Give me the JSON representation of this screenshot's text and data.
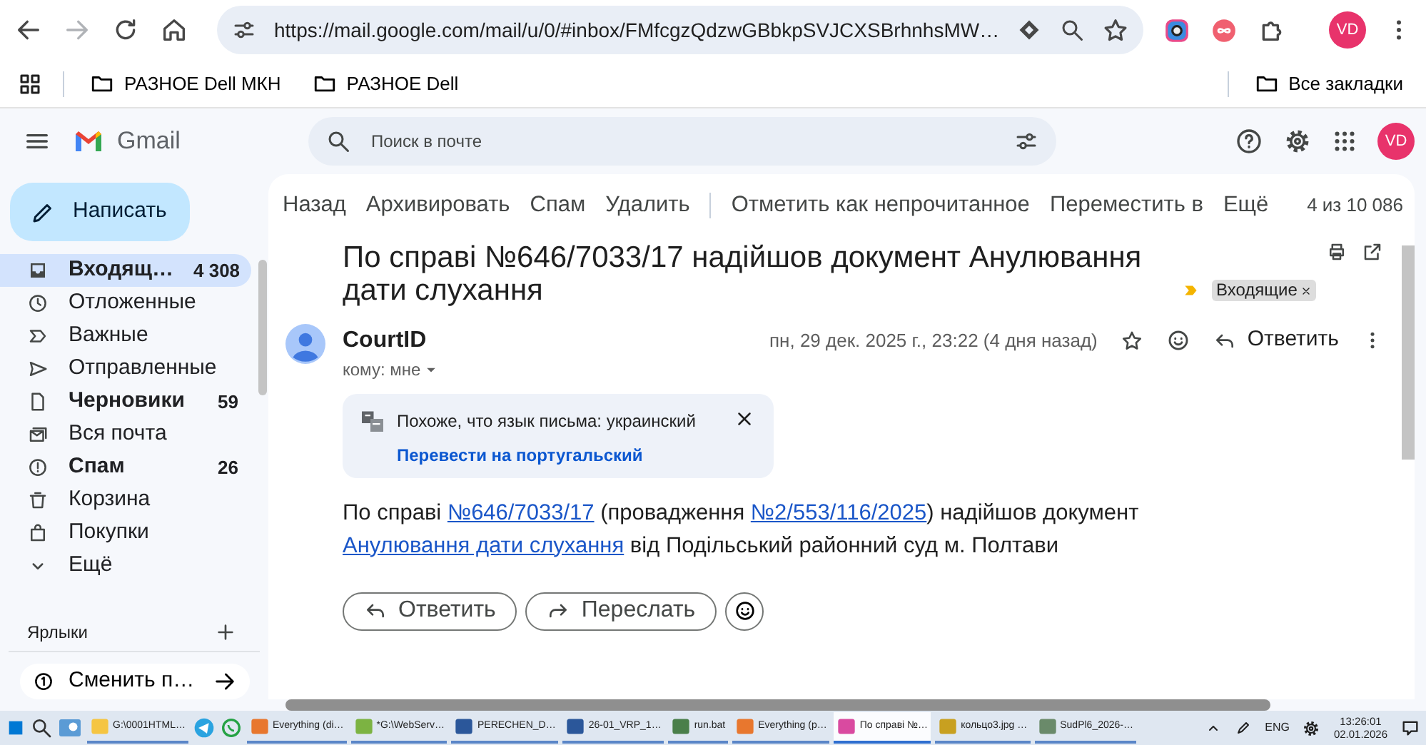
{
  "browser": {
    "url": "https://mail.google.com/mail/u/0/#inbox/FMfcgzQdzwGBbkpSVJCXSBrhnhsMW…",
    "profile": "VD",
    "bookmarks": [
      "РАЗНОЕ Dell МКН",
      "РАЗНОЕ Dell"
    ],
    "all_bookmarks": "Все закладки"
  },
  "gmail": {
    "product": "Gmail",
    "search_placeholder": "Поиск в почте",
    "account": "VD"
  },
  "sidebar": {
    "compose": "Написать",
    "folders": [
      {
        "label": "Входящ…",
        "count": "4 308",
        "unread": true,
        "selected": true
      },
      {
        "label": "Отложенные",
        "unread": false,
        "selected": false
      },
      {
        "label": "Важные",
        "unread": false,
        "selected": false
      },
      {
        "label": "Отправленные",
        "unread": false,
        "selected": false
      },
      {
        "label": "Черновики",
        "count": "59",
        "unread": true,
        "selected": false
      },
      {
        "label": "Вся почта",
        "unread": false,
        "selected": false
      },
      {
        "label": "Спам",
        "count": "26",
        "unread": true,
        "selected": false
      },
      {
        "label": "Корзина",
        "unread": false,
        "selected": false
      },
      {
        "label": "Покупки",
        "unread": false,
        "selected": false
      },
      {
        "label": "Ещё",
        "unread": false,
        "selected": false
      }
    ],
    "labels_heading": "Ярлыки",
    "switch_button": "Сменить п…"
  },
  "toolbar": {
    "action_groups": [
      [
        "Назад",
        "Архивировать",
        "Спам",
        "Удалить"
      ],
      [
        "Отметить как непрочитанное",
        "Переместить в",
        "Ещё"
      ]
    ],
    "pager": "4 из 10 086"
  },
  "message": {
    "subject": "По справі №646/7033/17 надійшов документ Анулювання дати слухання",
    "label_chip": "Входящие",
    "sender": "CourtID",
    "recipient": "кому: мне",
    "date": "пн, 29 дек. 2025 г., 23:22 (4 дня назад)",
    "reply": "Ответить",
    "translate": {
      "notice": "Похоже, что язык письма: украинский",
      "action": "Перевести на португальский"
    },
    "body": [
      {
        "kind": "text",
        "text": "По справі "
      },
      {
        "kind": "link",
        "text": "№646/7033/17"
      },
      {
        "kind": "text",
        "text": " (провадження "
      },
      {
        "kind": "link",
        "text": "№2/553/116/2025"
      },
      {
        "kind": "text",
        "text": ") надійшов документ "
      },
      {
        "kind": "link",
        "text": "Анулювання дати слухання"
      },
      {
        "kind": "text",
        "text": " від Подільський районний суд м. Полтави"
      }
    ],
    "buttons": [
      {
        "kind": "reply",
        "label": "Ответить"
      },
      {
        "kind": "forward",
        "label": "Переслать"
      }
    ]
  },
  "taskbar": {
    "items": [
      {
        "label": "G:\\0001HTML…",
        "selected": false
      },
      {
        "label": "Everything (di…",
        "selected": false
      },
      {
        "label": "*G:\\WebServ…",
        "selected": false
      },
      {
        "label": "PERECHEN_D…",
        "selected": false
      },
      {
        "label": "26-01_VRP_1…",
        "selected": false
      },
      {
        "label": "run.bat",
        "selected": false
      },
      {
        "label": "Everything (p…",
        "selected": false
      },
      {
        "label": "По справі №…",
        "selected": true
      },
      {
        "label": "кольцо3.jpg …",
        "selected": false
      },
      {
        "label": "SudPl6_2026-…",
        "selected": false
      }
    ],
    "language": "ENG",
    "time": "13:26:01",
    "date": "02.01.2026"
  }
}
